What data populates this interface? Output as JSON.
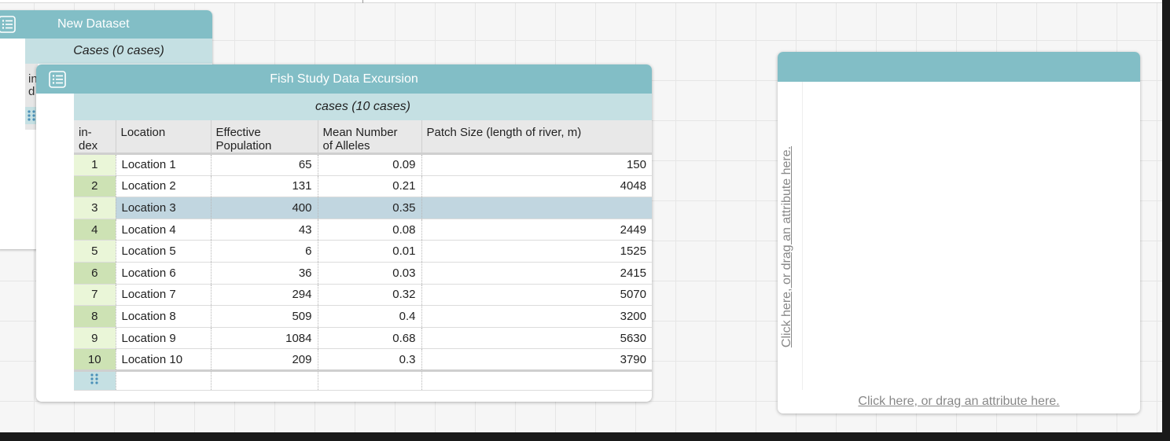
{
  "new_dataset": {
    "title": "New Dataset",
    "cases_label": "Cases (0 cases)",
    "index_stub": "in\nd"
  },
  "fish_table": {
    "title": "Fish Study Data Excursion",
    "cases_label": "cases (10 cases)",
    "columns": [
      "in-\ndex",
      "Location",
      "Effective\nPopulation",
      "Mean Number\nof Alleles",
      "Patch Size (length of river, m)"
    ],
    "rows": [
      {
        "index": "1",
        "location": "Location 1",
        "population": "65",
        "alleles": "0.09",
        "patch": "150"
      },
      {
        "index": "2",
        "location": "Location 2",
        "population": "131",
        "alleles": "0.21",
        "patch": "4048"
      },
      {
        "index": "3",
        "location": "Location 3",
        "population": "400",
        "alleles": "0.35",
        "patch": ""
      },
      {
        "index": "4",
        "location": "Location 4",
        "population": "43",
        "alleles": "0.08",
        "patch": "2449"
      },
      {
        "index": "5",
        "location": "Location 5",
        "population": "6",
        "alleles": "0.01",
        "patch": "1525"
      },
      {
        "index": "6",
        "location": "Location 6",
        "population": "36",
        "alleles": "0.03",
        "patch": "2415"
      },
      {
        "index": "7",
        "location": "Location 7",
        "population": "294",
        "alleles": "0.32",
        "patch": "5070"
      },
      {
        "index": "8",
        "location": "Location 8",
        "population": "509",
        "alleles": "0.4",
        "patch": "3200"
      },
      {
        "index": "9",
        "location": "Location 9",
        "population": "1084",
        "alleles": "0.68",
        "patch": "5630"
      },
      {
        "index": "10",
        "location": "Location 10",
        "population": "209",
        "alleles": "0.3",
        "patch": "3790"
      }
    ],
    "selected_row": 3
  },
  "graph": {
    "y_prompt": "Click here, or drag an attribute here.",
    "x_prompt": "Click here, or drag an attribute here."
  },
  "colors": {
    "title_bar": "#82bec6",
    "cases_bar": "#c5e0e3",
    "selected_row": "#c1d6e0",
    "index_odd": "#eaf6d8",
    "index_even": "#cde2b4"
  },
  "icons": {
    "table_icon": "table-list-icon",
    "drag_handle": "grip-dots-icon"
  }
}
